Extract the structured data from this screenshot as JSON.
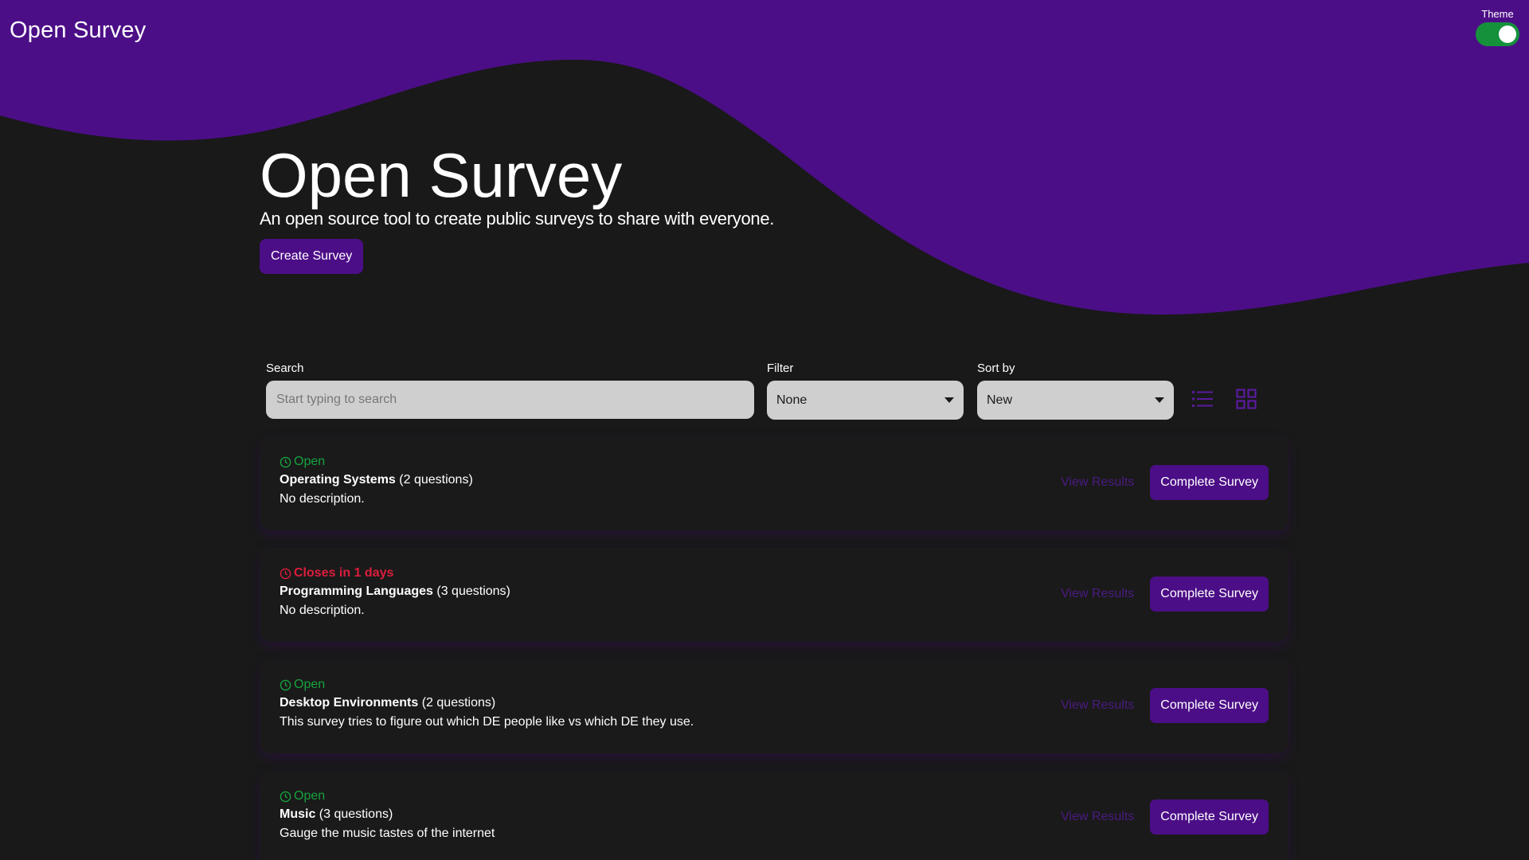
{
  "colors": {
    "accent": "#4c0e87",
    "background": "#191919",
    "status_open": "#17a23f",
    "status_closing": "#dc1d3c",
    "toggle_on": "#15913c"
  },
  "header": {
    "brand": "Open Survey",
    "theme_label": "Theme",
    "theme_toggle_on": true
  },
  "hero": {
    "title": "Open Survey",
    "subtitle": "An open source tool to create public surveys to share with everyone.",
    "create_button": "Create Survey"
  },
  "controls": {
    "search_label": "Search",
    "search_placeholder": "Start typing to search",
    "search_value": "",
    "filter_label": "Filter",
    "filter_value": "None",
    "sort_label": "Sort by",
    "sort_value": "New",
    "view_list_icon": "list-view-icon",
    "view_grid_icon": "grid-view-icon"
  },
  "surveys": [
    {
      "status": "Open",
      "status_kind": "open",
      "name": "Operating Systems",
      "questions": "(2 questions)",
      "description": "No description.",
      "results_label": "View Results",
      "complete_label": "Complete Survey"
    },
    {
      "status": "Closes in 1 days",
      "status_kind": "closing",
      "name": "Programming Languages",
      "questions": "(3 questions)",
      "description": "No description.",
      "results_label": "View Results",
      "complete_label": "Complete Survey"
    },
    {
      "status": "Open",
      "status_kind": "open",
      "name": "Desktop Environments",
      "questions": "(2 questions)",
      "description": "This survey tries to figure out which DE people like vs which DE they use.",
      "results_label": "View Results",
      "complete_label": "Complete Survey"
    },
    {
      "status": "Open",
      "status_kind": "open",
      "name": "Music",
      "questions": "(3 questions)",
      "description": "Gauge the music tastes of the internet",
      "results_label": "View Results",
      "complete_label": "Complete Survey"
    }
  ]
}
